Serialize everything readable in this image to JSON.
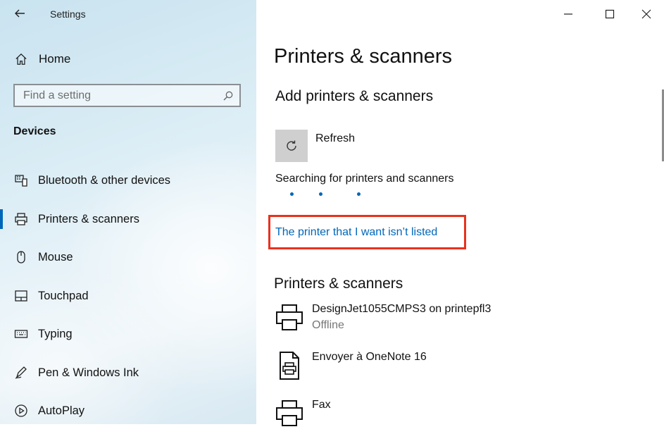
{
  "window": {
    "title": "Settings",
    "controls": {
      "minimize": "minimize-icon",
      "maximize": "maximize-icon",
      "close": "close-icon"
    }
  },
  "sidebar": {
    "home_label": "Home",
    "search_placeholder": "Find a setting",
    "section_title": "Devices",
    "items": [
      {
        "label": "Bluetooth & other devices",
        "icon": "bluetooth-devices-icon",
        "selected": false
      },
      {
        "label": "Printers & scanners",
        "icon": "printer-icon",
        "selected": true
      },
      {
        "label": "Mouse",
        "icon": "mouse-icon",
        "selected": false
      },
      {
        "label": "Touchpad",
        "icon": "touchpad-icon",
        "selected": false
      },
      {
        "label": "Typing",
        "icon": "keyboard-icon",
        "selected": false
      },
      {
        "label": "Pen & Windows Ink",
        "icon": "pen-icon",
        "selected": false
      },
      {
        "label": "AutoPlay",
        "icon": "autoplay-icon",
        "selected": false
      }
    ]
  },
  "main": {
    "page_title": "Printers & scanners",
    "add_section_title": "Add printers & scanners",
    "refresh_label": "Refresh",
    "searching_text": "Searching for printers and scanners",
    "not_listed_link": "The printer that I want isn’t listed",
    "list_section_title": "Printers & scanners",
    "printers": [
      {
        "name": "DesignJet1055CMPS3 on printepfl3",
        "status": "Offline",
        "icon": "printer-icon"
      },
      {
        "name": "Envoyer à OneNote 16",
        "status": "",
        "icon": "onenote-printer-icon"
      },
      {
        "name": "Fax",
        "status": "",
        "icon": "fax-printer-icon"
      }
    ]
  },
  "colors": {
    "accent": "#0067b8",
    "highlight_box": "#e8321f"
  }
}
